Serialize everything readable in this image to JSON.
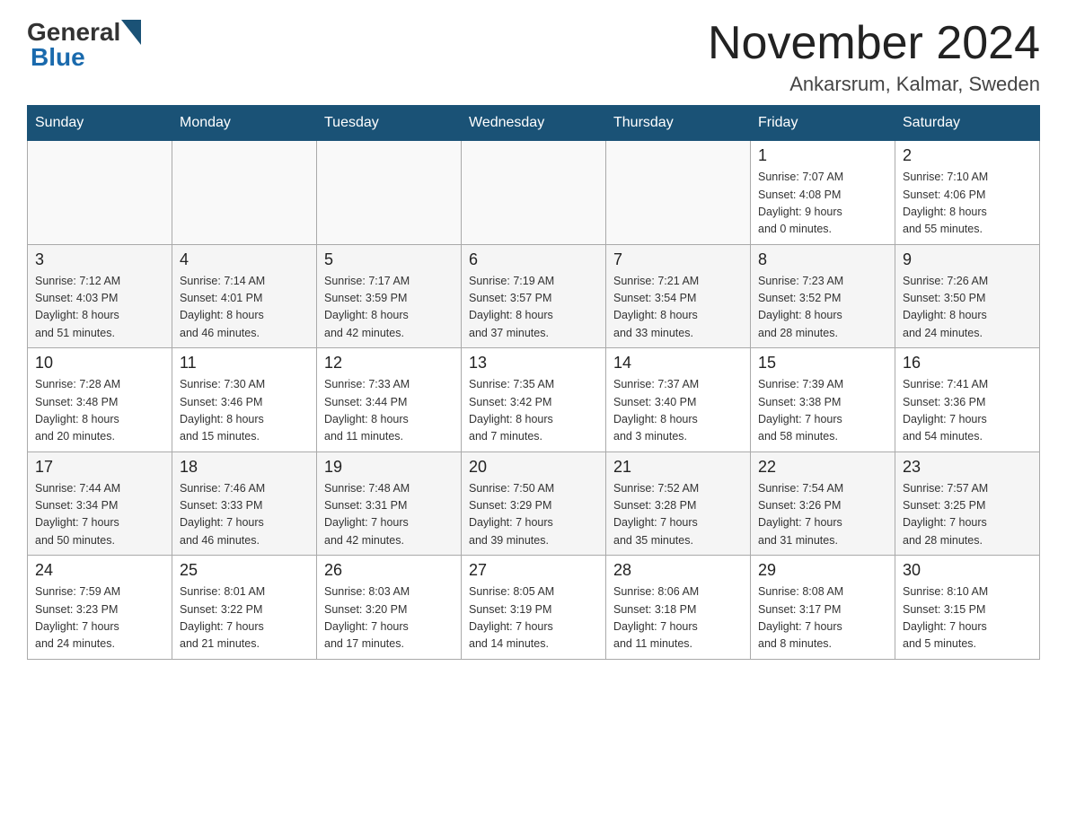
{
  "header": {
    "logo_general": "General",
    "logo_blue": "Blue",
    "month_title": "November 2024",
    "location": "Ankarsrum, Kalmar, Sweden"
  },
  "weekdays": [
    "Sunday",
    "Monday",
    "Tuesday",
    "Wednesday",
    "Thursday",
    "Friday",
    "Saturday"
  ],
  "weeks": [
    [
      {
        "day": "",
        "info": ""
      },
      {
        "day": "",
        "info": ""
      },
      {
        "day": "",
        "info": ""
      },
      {
        "day": "",
        "info": ""
      },
      {
        "day": "",
        "info": ""
      },
      {
        "day": "1",
        "info": "Sunrise: 7:07 AM\nSunset: 4:08 PM\nDaylight: 9 hours\nand 0 minutes."
      },
      {
        "day": "2",
        "info": "Sunrise: 7:10 AM\nSunset: 4:06 PM\nDaylight: 8 hours\nand 55 minutes."
      }
    ],
    [
      {
        "day": "3",
        "info": "Sunrise: 7:12 AM\nSunset: 4:03 PM\nDaylight: 8 hours\nand 51 minutes."
      },
      {
        "day": "4",
        "info": "Sunrise: 7:14 AM\nSunset: 4:01 PM\nDaylight: 8 hours\nand 46 minutes."
      },
      {
        "day": "5",
        "info": "Sunrise: 7:17 AM\nSunset: 3:59 PM\nDaylight: 8 hours\nand 42 minutes."
      },
      {
        "day": "6",
        "info": "Sunrise: 7:19 AM\nSunset: 3:57 PM\nDaylight: 8 hours\nand 37 minutes."
      },
      {
        "day": "7",
        "info": "Sunrise: 7:21 AM\nSunset: 3:54 PM\nDaylight: 8 hours\nand 33 minutes."
      },
      {
        "day": "8",
        "info": "Sunrise: 7:23 AM\nSunset: 3:52 PM\nDaylight: 8 hours\nand 28 minutes."
      },
      {
        "day": "9",
        "info": "Sunrise: 7:26 AM\nSunset: 3:50 PM\nDaylight: 8 hours\nand 24 minutes."
      }
    ],
    [
      {
        "day": "10",
        "info": "Sunrise: 7:28 AM\nSunset: 3:48 PM\nDaylight: 8 hours\nand 20 minutes."
      },
      {
        "day": "11",
        "info": "Sunrise: 7:30 AM\nSunset: 3:46 PM\nDaylight: 8 hours\nand 15 minutes."
      },
      {
        "day": "12",
        "info": "Sunrise: 7:33 AM\nSunset: 3:44 PM\nDaylight: 8 hours\nand 11 minutes."
      },
      {
        "day": "13",
        "info": "Sunrise: 7:35 AM\nSunset: 3:42 PM\nDaylight: 8 hours\nand 7 minutes."
      },
      {
        "day": "14",
        "info": "Sunrise: 7:37 AM\nSunset: 3:40 PM\nDaylight: 8 hours\nand 3 minutes."
      },
      {
        "day": "15",
        "info": "Sunrise: 7:39 AM\nSunset: 3:38 PM\nDaylight: 7 hours\nand 58 minutes."
      },
      {
        "day": "16",
        "info": "Sunrise: 7:41 AM\nSunset: 3:36 PM\nDaylight: 7 hours\nand 54 minutes."
      }
    ],
    [
      {
        "day": "17",
        "info": "Sunrise: 7:44 AM\nSunset: 3:34 PM\nDaylight: 7 hours\nand 50 minutes."
      },
      {
        "day": "18",
        "info": "Sunrise: 7:46 AM\nSunset: 3:33 PM\nDaylight: 7 hours\nand 46 minutes."
      },
      {
        "day": "19",
        "info": "Sunrise: 7:48 AM\nSunset: 3:31 PM\nDaylight: 7 hours\nand 42 minutes."
      },
      {
        "day": "20",
        "info": "Sunrise: 7:50 AM\nSunset: 3:29 PM\nDaylight: 7 hours\nand 39 minutes."
      },
      {
        "day": "21",
        "info": "Sunrise: 7:52 AM\nSunset: 3:28 PM\nDaylight: 7 hours\nand 35 minutes."
      },
      {
        "day": "22",
        "info": "Sunrise: 7:54 AM\nSunset: 3:26 PM\nDaylight: 7 hours\nand 31 minutes."
      },
      {
        "day": "23",
        "info": "Sunrise: 7:57 AM\nSunset: 3:25 PM\nDaylight: 7 hours\nand 28 minutes."
      }
    ],
    [
      {
        "day": "24",
        "info": "Sunrise: 7:59 AM\nSunset: 3:23 PM\nDaylight: 7 hours\nand 24 minutes."
      },
      {
        "day": "25",
        "info": "Sunrise: 8:01 AM\nSunset: 3:22 PM\nDaylight: 7 hours\nand 21 minutes."
      },
      {
        "day": "26",
        "info": "Sunrise: 8:03 AM\nSunset: 3:20 PM\nDaylight: 7 hours\nand 17 minutes."
      },
      {
        "day": "27",
        "info": "Sunrise: 8:05 AM\nSunset: 3:19 PM\nDaylight: 7 hours\nand 14 minutes."
      },
      {
        "day": "28",
        "info": "Sunrise: 8:06 AM\nSunset: 3:18 PM\nDaylight: 7 hours\nand 11 minutes."
      },
      {
        "day": "29",
        "info": "Sunrise: 8:08 AM\nSunset: 3:17 PM\nDaylight: 7 hours\nand 8 minutes."
      },
      {
        "day": "30",
        "info": "Sunrise: 8:10 AM\nSunset: 3:15 PM\nDaylight: 7 hours\nand 5 minutes."
      }
    ]
  ]
}
